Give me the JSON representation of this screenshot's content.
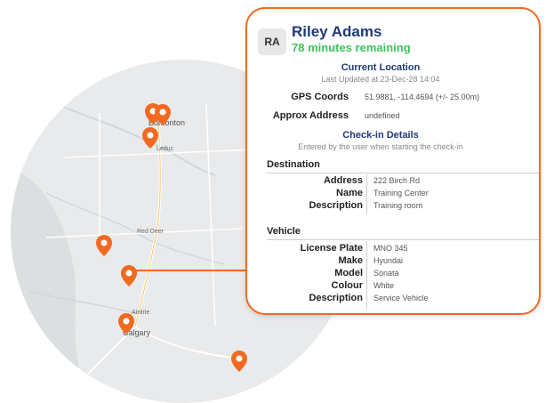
{
  "map": {
    "cities": {
      "edmonton": "Edmonton",
      "leduc": "Leduc",
      "red_deer": "Red Deer",
      "airdrie": "Airdrie",
      "calgary": "Calgary"
    },
    "pin_color": "#f26a21"
  },
  "user": {
    "initials": "RA",
    "name": "Riley Adams",
    "remaining": "78 minutes remaining"
  },
  "current_location": {
    "title": "Current Location",
    "updated": "Last Updated at 23-Dec-28 14:04",
    "gps_label": "GPS Coords",
    "gps_value": "51.9881, -114.4694 (+/- 25.00m)",
    "address_label": "Approx Address",
    "address_value": "undefined"
  },
  "checkin": {
    "title": "Check-in Details",
    "subtitle": "Entered by the user when starting the check-in"
  },
  "destination": {
    "title": "Destination",
    "address_label": "Address",
    "address_value": "222 Birch Rd",
    "name_label": "Name",
    "name_value": "Training Center",
    "description_label": "Description",
    "description_value": "Training room"
  },
  "vehicle": {
    "title": "Vehicle",
    "plate_label": "License Plate",
    "plate_value": "MNO 345",
    "make_label": "Make",
    "make_value": "Hyundai",
    "model_label": "Model",
    "model_value": "Sonata",
    "colour_label": "Colour",
    "colour_value": "White",
    "description_label": "Description",
    "description_value": "Service Vehicle"
  }
}
